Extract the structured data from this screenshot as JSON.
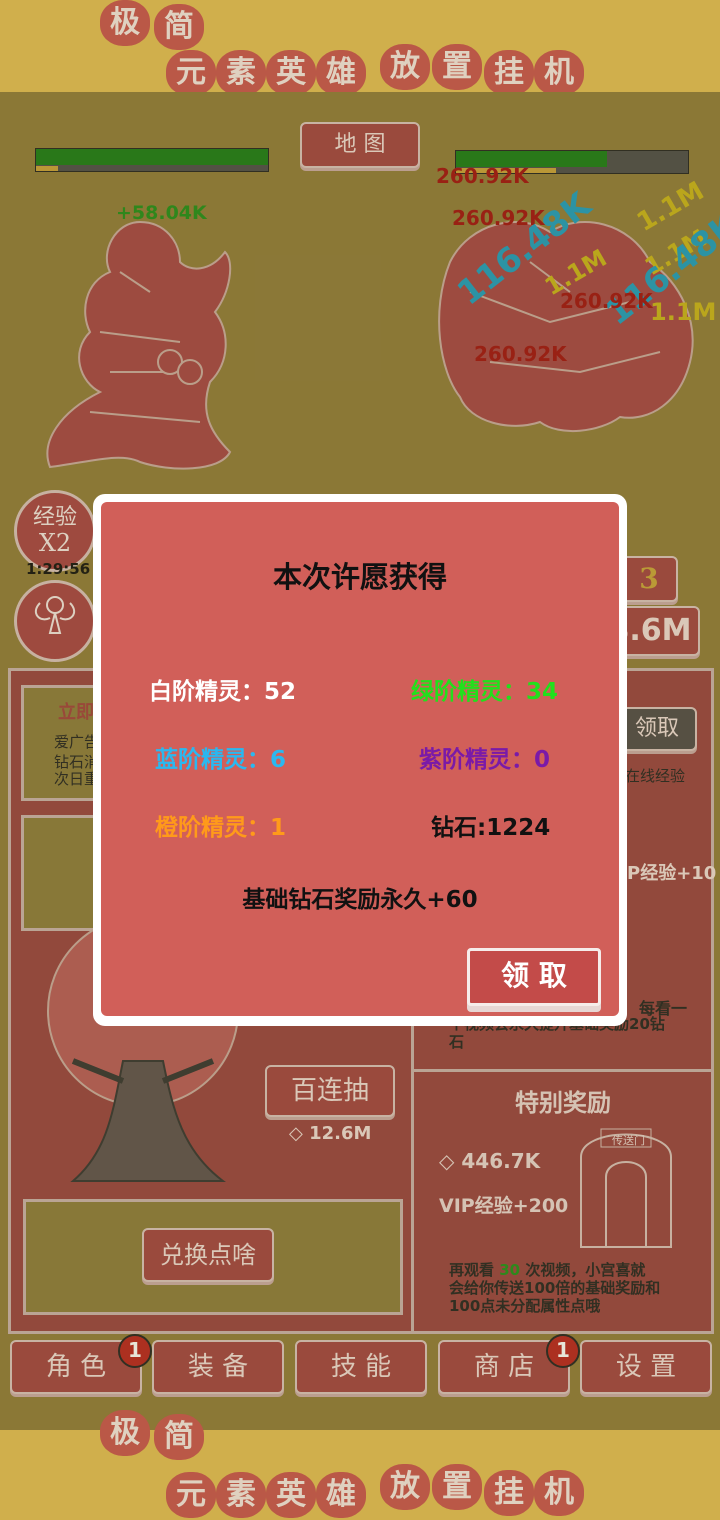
{
  "banner": {
    "title_chars": [
      "极",
      "简",
      "元",
      "素",
      "英",
      "雄",
      "放",
      "置",
      "挂",
      "机"
    ]
  },
  "arena": {
    "map_button": "地 图",
    "player_heal": "+58.04K",
    "damage_numbers": [
      "260.92K",
      "260.92K",
      "116.48K",
      "1.1M",
      "1.1M",
      "1.1M",
      "1.1M",
      "116.48K",
      "260.92K",
      "260.92K",
      "1.1M",
      "260.92K"
    ],
    "player_hp_fraction": 1.0,
    "enemy_hp_fraction": 0.65
  },
  "side": {
    "exp_boost_line1": "经验",
    "exp_boost_line2": "X2",
    "exp_timer": "1:29:56",
    "level_badge": "3",
    "power_value": "8.6M"
  },
  "panels": {
    "left_top_title": "立即",
    "left_top_lines": [
      "爱广告",
      "钻石消",
      "次日重"
    ],
    "claim_button": "领取",
    "online_exp": "在线经验",
    "vip_exp_10": "P经验+10",
    "hundred_draw": "百连抽",
    "hundred_draw_cost": "12.6M",
    "exchange_points": "兑换点啥",
    "watch_tip_line1": "每看一",
    "watch_tip_line2": "个视频会永久提升基础奖励20钻",
    "watch_tip_line3": "石",
    "special_reward_title": "特别奖励",
    "portal_label": "传送门",
    "special_diamonds": "446.7K",
    "special_vip": "VIP经验+200",
    "special_desc_prefix": "再观看",
    "special_desc_count": "30",
    "special_desc_line1": "次视频，小宫喜就",
    "special_desc_line2": "会给你传送100倍的基础奖励和",
    "special_desc_line3": "100点未分配属性点哦"
  },
  "nav": {
    "tabs": [
      {
        "label": "角 色",
        "badge": "1"
      },
      {
        "label": "装 备",
        "badge": ""
      },
      {
        "label": "技 能",
        "badge": ""
      },
      {
        "label": "商 店",
        "badge": "1"
      },
      {
        "label": "设 置",
        "badge": ""
      }
    ]
  },
  "dialog": {
    "title": "本次许愿获得",
    "white_label": "白阶精灵：52",
    "green_label": "绿阶精灵：34",
    "blue_label": "蓝阶精灵：6",
    "purple_label": "紫阶精灵：0",
    "orange_label": "橙阶精灵：1",
    "diamond_label": "钻石:1224",
    "bonus_text": "基础钻石奖励永久+60",
    "claim_button": "领 取"
  },
  "colors": {
    "white_tier": "#ffffff",
    "green_tier": "#22e01c",
    "blue_tier": "#2ab8f0",
    "purple_tier": "#7a1aa8",
    "orange_tier": "#ff9a1a",
    "damage_red": "#a01010",
    "damage_yellow": "#c9b21a",
    "damage_cyan": "#1b9cc0"
  }
}
